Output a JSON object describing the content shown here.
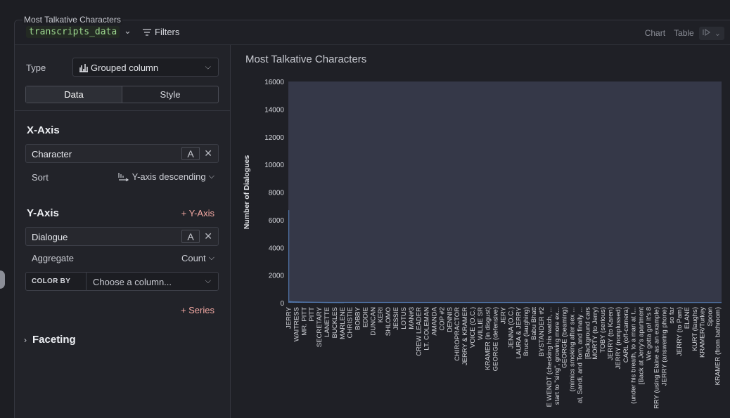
{
  "panel": {
    "title": "Most Talkative Characters",
    "dataset": "transcripts_data",
    "filters_label": "Filters",
    "view_chart": "Chart",
    "view_table": "Table"
  },
  "config": {
    "type_label": "Type",
    "type_value": "Grouped column",
    "tabs": [
      "Data",
      "Style"
    ],
    "x_axis": {
      "heading": "X-Axis",
      "column": "Character",
      "sort_label": "Sort",
      "sort_value": "Y-axis descending"
    },
    "y_axis": {
      "heading": "Y-Axis",
      "add_label": "+ Y-Axis",
      "column": "Dialogue",
      "aggregate_label": "Aggregate",
      "aggregate_value": "Count"
    },
    "color_by": {
      "label": "COLOR BY",
      "placeholder": "Choose a column..."
    },
    "add_series": "+ Series",
    "faceting": "Faceting",
    "a_glyph": "A",
    "x_glyph": "✕"
  },
  "colors": {
    "accent_link": "#f3a8a2",
    "dataset_green": "#9dd88f",
    "bar": "#4f73a6",
    "plot_bg": "#353848"
  },
  "chart_data": {
    "type": "bar",
    "title": "Most Talkative Characters",
    "ylabel": "Number of Dialogues",
    "xlabel": "",
    "ylim": [
      0,
      16000
    ],
    "yticks": [
      0,
      2000,
      4000,
      6000,
      8000,
      10000,
      12000,
      14000,
      16000
    ],
    "grid": false,
    "categories": [
      "JERRY",
      "WAITRESS",
      "MR. PITT",
      "PITT",
      "SECRETARY",
      "LANETTE",
      "BUCKLES",
      "MARLENE",
      "CHRISTIE",
      "BOBBY",
      "EDDIE",
      "DUNCAN",
      "KERI",
      "SHLOMO",
      "JESSIE",
      "LOTUS",
      "MAN#3",
      "CREW LEADER",
      "LT. COLEMAN",
      "AMANDA",
      "COP #2",
      "DENNIS",
      "CHIROPRACTOR",
      "JERRY & KRAMER",
      "VOICE (O.C.)",
      "WILLIE SR",
      "KRAMER (in disgust)",
      "GEORGE (defensive)",
      "JERY",
      "JENNA (O.C.)",
      "LAURA & JERRY",
      "Bruce (laughing)",
      "Babu Bhatt",
      "BYSTANDER #2",
      "E WENDT (checking his watch, ...",
      "start to \"sing\", growing more ex...",
      "GEORGE (beaming)",
      "(mimics smoking after sex ...",
      "al, Sandi, and Tom, and finally ...",
      "[Background cars",
      "MORTY (to Jerry)",
      "TOBY (serious)",
      "JERRY (to Karen)",
      "JERRY (nonplussed)",
      "CARL (off-camera)",
      "(under his breath, to a man at t...",
      "[Back at Jerry's apartment",
      "We gotta go! It's 8",
      "RRY (using Elaine as an example)",
      "JERRY (answering phone)",
      "so far",
      "JERRY (to Pam)",
      "ELANE",
      "KURT (laughs)",
      "KRAMER/Turkey",
      "Spoon",
      "KRAMER (from bathroom)"
    ],
    "values": [
      6700,
      130,
      120,
      110,
      100,
      95,
      90,
      85,
      80,
      75,
      70,
      66,
      62,
      58,
      55,
      52,
      48,
      45,
      42,
      40,
      37,
      35,
      33,
      31,
      29,
      27,
      25,
      23,
      21,
      20,
      19,
      18,
      17,
      16,
      15,
      14,
      13,
      12,
      11,
      10,
      9,
      8,
      8,
      7,
      7,
      6,
      6,
      5,
      5,
      4,
      4,
      3,
      3,
      2,
      2,
      2,
      1
    ]
  }
}
